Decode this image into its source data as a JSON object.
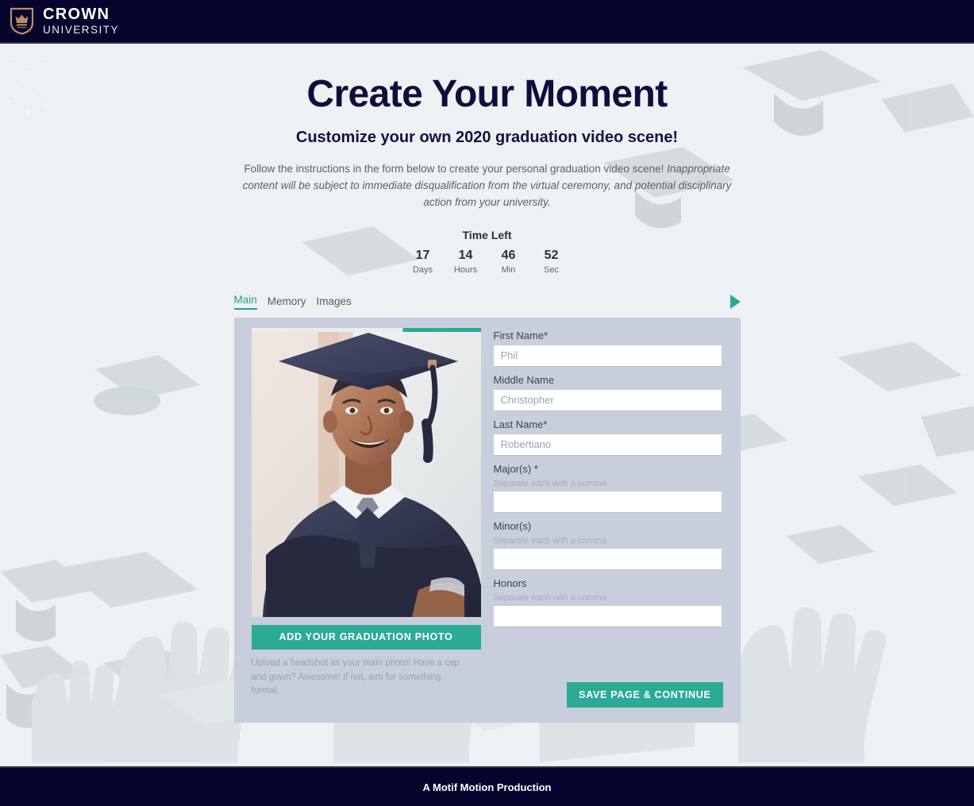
{
  "header": {
    "brand_line1": "CROWN",
    "brand_line2": "UNIVERSITY",
    "logo_icon": "shield-crown-icon",
    "bg_color": "#04042c"
  },
  "hero": {
    "title": "Create Your Moment",
    "subtitle": "Customize your own 2020 graduation video scene!",
    "description_plain": "Follow the instructions in the form below to create your personal graduation video scene!",
    "description_italic": "Inappropriate content will be subject to immediate disqualification from the virtual ceremony, and potential disciplinary action from your university."
  },
  "countdown": {
    "title": "Time Left",
    "units": [
      {
        "value": "17",
        "label": "Days"
      },
      {
        "value": "14",
        "label": "Hours"
      },
      {
        "value": "46",
        "label": "Min"
      },
      {
        "value": "52",
        "label": "Sec"
      }
    ]
  },
  "tabs": {
    "items": [
      {
        "label": "Main",
        "active": true
      },
      {
        "label": "Memory",
        "active": false
      },
      {
        "label": "Images",
        "active": false
      }
    ],
    "next_icon": "play-triangle-icon"
  },
  "form": {
    "photo": {
      "alt": "graduate-in-cap-and-gown-photo",
      "button_label": "ADD YOUR GRADUATION PHOTO",
      "hint": "Upload a headshot as your main photo! Have a cap and gown? Awesome! If not, aim for something formal."
    },
    "fields": [
      {
        "label": "First Name*",
        "hint": "",
        "placeholder": "Phil",
        "value": ""
      },
      {
        "label": "Middle Name",
        "hint": "",
        "placeholder": "Christopher",
        "value": ""
      },
      {
        "label": "Last Name*",
        "hint": "",
        "placeholder": "Robertiano",
        "value": ""
      },
      {
        "label": "Major(s) *",
        "hint": "Separate each with a comma",
        "placeholder": "",
        "value": ""
      },
      {
        "label": "Minor(s)",
        "hint": "Separate each with a comma",
        "placeholder": "",
        "value": ""
      },
      {
        "label": "Honors",
        "hint": "Separate each with a comma",
        "placeholder": "",
        "value": ""
      }
    ],
    "save_label": "SAVE PAGE & CONTINUE"
  },
  "footer": {
    "text": "A Motif Motion Production"
  },
  "colors": {
    "navy": "#04042c",
    "teal": "#2bab96",
    "panel": "#c8cedb",
    "page_bg": "#eef1f2"
  }
}
